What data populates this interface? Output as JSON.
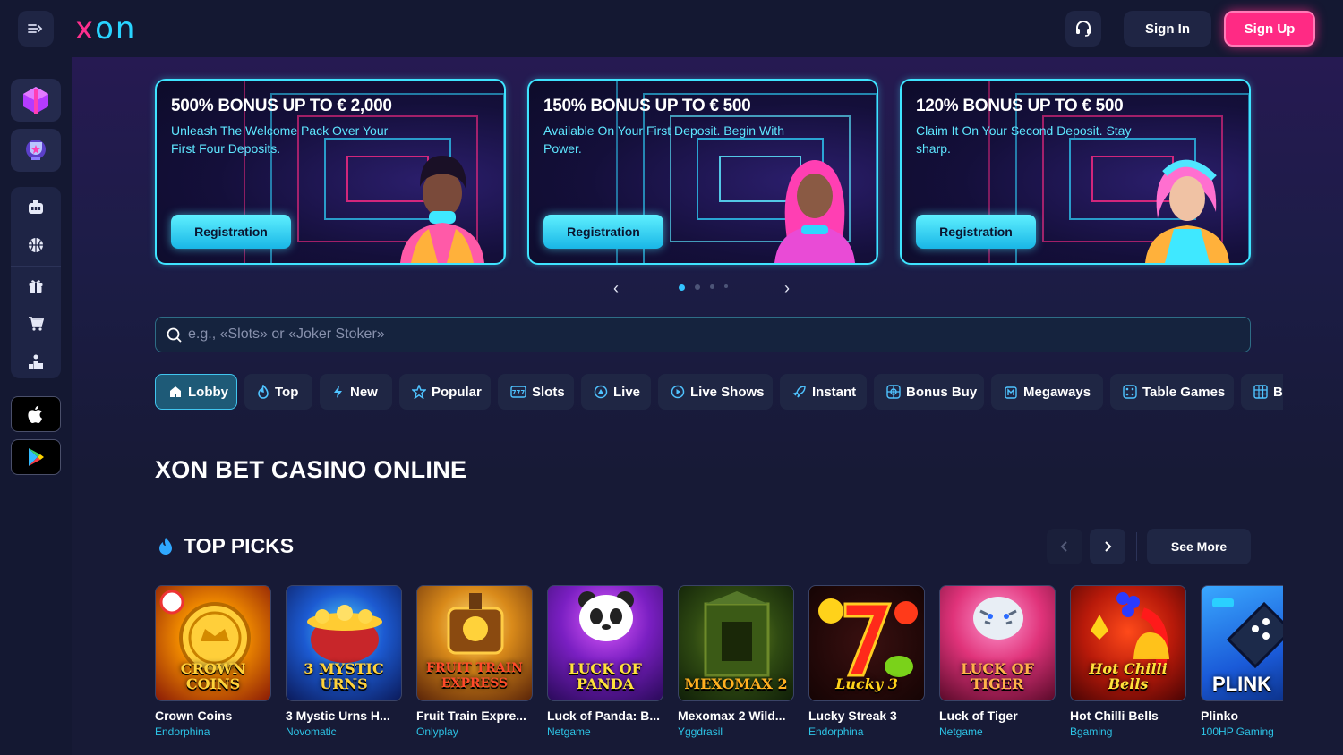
{
  "header": {
    "logo_x": "x",
    "logo_on": "on",
    "signin_label": "Sign In",
    "signup_label": "Sign Up",
    "icons": [
      "menu-expand-icon",
      "headset-icon"
    ]
  },
  "sidebar": {
    "promo_items": [
      "gift-box-icon",
      "trophy-icon"
    ],
    "items": [
      "casino-icon",
      "basketball-icon",
      "gift-icon",
      "cart-icon",
      "podium-icon"
    ],
    "apps": [
      "apple-icon",
      "google-play-icon"
    ]
  },
  "banners": [
    {
      "title": "500% BONUS UP TO € 2,000",
      "text": "Unleash The Welcome Pack Over Your First Four Deposits.",
      "button": "Registration"
    },
    {
      "title": "150% BONUS UP TO € 500",
      "text": "Available On Your First Deposit. Begin With Power.",
      "button": "Registration"
    },
    {
      "title": "120% BONUS UP TO € 500",
      "text": "Claim It On Your Second Deposit. Stay sharp.",
      "button": "Registration"
    }
  ],
  "carousel": {
    "prev": "‹",
    "next": "›",
    "dots": 4,
    "active_dot": 0
  },
  "search": {
    "placeholder": "e.g., «Slots» or «Joker Stoker»",
    "value": ""
  },
  "categories": [
    {
      "label": "Lobby",
      "icon": "home-icon",
      "active": true
    },
    {
      "label": "Top",
      "icon": "fire-icon"
    },
    {
      "label": "New",
      "icon": "bolt-icon"
    },
    {
      "label": "Popular",
      "icon": "star-icon"
    },
    {
      "label": "Slots",
      "icon": "slot-777-icon"
    },
    {
      "label": "Live",
      "icon": "live-icon"
    },
    {
      "label": "Live Shows",
      "icon": "play-icon"
    },
    {
      "label": "Instant",
      "icon": "rocket-icon"
    },
    {
      "label": "Bonus Buy",
      "icon": "bonus-icon"
    },
    {
      "label": "Megaways",
      "icon": "megaways-icon"
    },
    {
      "label": "Table Games",
      "icon": "dice-icon"
    },
    {
      "label": "B",
      "icon": "grid-icon"
    }
  ],
  "section_title": "XON BET CASINO ONLINE",
  "top_picks": {
    "title": "TOP PICKS",
    "see_more": "See More",
    "games": [
      {
        "name": "Crown Coins",
        "provider": "Endorphina",
        "art": "CROWN COINS"
      },
      {
        "name": "3 Mystic Urns H...",
        "provider": "Novomatic",
        "art": "3 MYSTIC URNS"
      },
      {
        "name": "Fruit Train Expre...",
        "provider": "Onlyplay",
        "art": "FRUIT TRAIN EXPRESS"
      },
      {
        "name": "Luck of Panda: B...",
        "provider": "Netgame",
        "art": "LUCK OF PANDA"
      },
      {
        "name": "Mexomax 2 Wild...",
        "provider": "Yggdrasil",
        "art": "MEXOMAX 2"
      },
      {
        "name": "Lucky Streak 3",
        "provider": "Endorphina",
        "art": "Lucky 3"
      },
      {
        "name": "Luck of Tiger",
        "provider": "Netgame",
        "art": "LUCK OF TIGER"
      },
      {
        "name": "Hot Chilli Bells",
        "provider": "Bgaming",
        "art": "Hot Chilli Bells"
      },
      {
        "name": "Plinko",
        "provider": "100HP Gaming",
        "art": "PLINK"
      }
    ]
  },
  "colors": {
    "accent_pink": "#ff2a84",
    "accent_cyan": "#3fe4ff",
    "provider_text": "#2dc4e6",
    "background": "#161a33"
  }
}
